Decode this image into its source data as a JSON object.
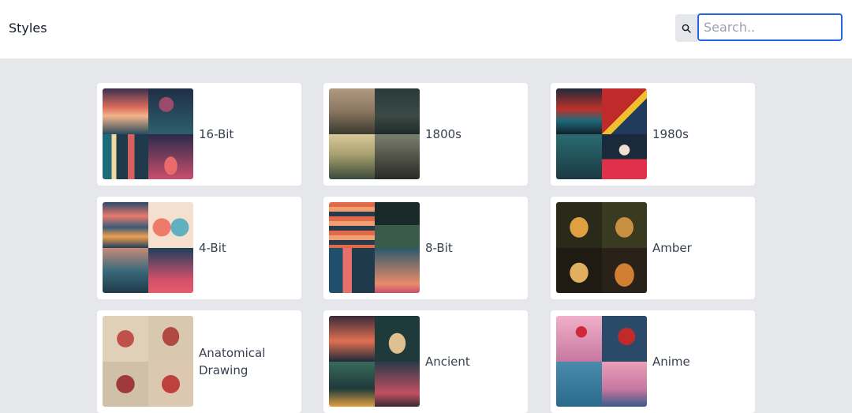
{
  "header": {
    "title": "Styles",
    "search_placeholder": "Search..",
    "search_icon": "search-icon"
  },
  "styles": [
    {
      "label": "16-Bit",
      "colors": [
        "#2b3a55",
        "#e8785a",
        "#1f4b5e",
        "#c94f6d"
      ]
    },
    {
      "label": "1800s",
      "colors": [
        "#9c8a72",
        "#2d3a35",
        "#c7b98f",
        "#4a4a40"
      ]
    },
    {
      "label": "1980s",
      "colors": [
        "#1d3a4a",
        "#d63a2f",
        "#2a6f7a",
        "#e23b5a"
      ]
    },
    {
      "label": "4-Bit",
      "colors": [
        "#2a4a6a",
        "#f06a6a",
        "#c9746a",
        "#1f3f5a"
      ]
    },
    {
      "label": "8-Bit",
      "colors": [
        "#e06a4a",
        "#223a3a",
        "#1f4f6a",
        "#3a6a6a"
      ]
    },
    {
      "label": "Amber",
      "colors": [
        "#3a3020",
        "#5a4a20",
        "#2a2218",
        "#3a2a18"
      ]
    },
    {
      "label": "Anatomical Drawing",
      "colors": [
        "#d8c8b0",
        "#cdbaa0",
        "#c8b8a0",
        "#d4c0a8"
      ]
    },
    {
      "label": "Ancient",
      "colors": [
        "#3a2a3a",
        "#1f3a3a",
        "#2a4a3a",
        "#3a2a30"
      ]
    },
    {
      "label": "Anime",
      "colors": [
        "#e8a0b8",
        "#2a4a6a",
        "#4a8aaa",
        "#d890b0"
      ]
    }
  ]
}
